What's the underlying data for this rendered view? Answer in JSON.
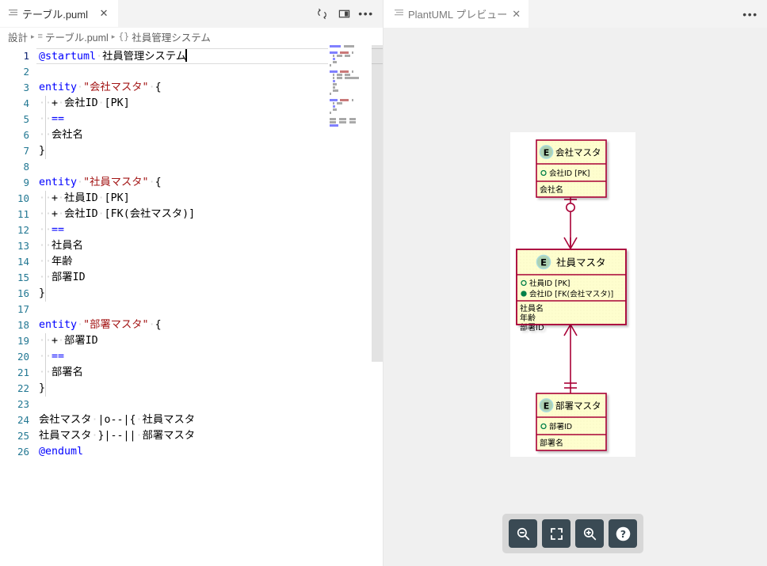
{
  "editor": {
    "tab": {
      "label": "テーブル.puml",
      "close_label": "✕",
      "file_icon": "file-code-icon"
    },
    "actions": {
      "sync_icon": "sync-changes-icon",
      "split_icon": "split-editor-right-icon",
      "more_label": "•••"
    },
    "breadcrumb": {
      "items": [
        {
          "label": "設計",
          "sym": ""
        },
        {
          "label": "テーブル.puml",
          "sym": "≡"
        },
        {
          "label": "社員管理システム",
          "sym": "{}"
        }
      ],
      "separator": "▸"
    },
    "code": {
      "line_numbers": [
        1,
        2,
        3,
        4,
        5,
        6,
        7,
        8,
        9,
        10,
        11,
        12,
        13,
        14,
        15,
        16,
        17,
        18,
        19,
        20,
        21,
        22,
        23,
        24,
        25,
        26
      ],
      "active_line": 1,
      "lines": [
        {
          "n": 1,
          "tokens": [
            {
              "t": "@startuml",
              "c": "kw"
            },
            {
              "t": "·",
              "c": "ws"
            },
            {
              "t": "社員管理システム",
              "c": "plain"
            }
          ],
          "caret": true
        },
        {
          "n": 2,
          "tokens": []
        },
        {
          "n": 3,
          "tokens": [
            {
              "t": "entity",
              "c": "kw"
            },
            {
              "t": "·",
              "c": "ws"
            },
            {
              "t": "\"会社マスタ\"",
              "c": "str"
            },
            {
              "t": "·",
              "c": "ws"
            },
            {
              "t": "{",
              "c": "plain"
            }
          ]
        },
        {
          "n": 4,
          "tokens": [
            {
              "t": "··",
              "c": "ws"
            },
            {
              "t": "+",
              "c": "plain"
            },
            {
              "t": "·",
              "c": "ws"
            },
            {
              "t": "会社ID",
              "c": "plain"
            },
            {
              "t": "·",
              "c": "ws"
            },
            {
              "t": "[PK]",
              "c": "plain"
            }
          ]
        },
        {
          "n": 5,
          "tokens": [
            {
              "t": "··",
              "c": "ws"
            },
            {
              "t": "==",
              "c": "op"
            }
          ]
        },
        {
          "n": 6,
          "tokens": [
            {
              "t": "··",
              "c": "ws"
            },
            {
              "t": "会社名",
              "c": "plain"
            }
          ]
        },
        {
          "n": 7,
          "tokens": [
            {
              "t": "}",
              "c": "plain"
            }
          ]
        },
        {
          "n": 8,
          "tokens": []
        },
        {
          "n": 9,
          "tokens": [
            {
              "t": "entity",
              "c": "kw"
            },
            {
              "t": "·",
              "c": "ws"
            },
            {
              "t": "\"社員マスタ\"",
              "c": "str"
            },
            {
              "t": "·",
              "c": "ws"
            },
            {
              "t": "{",
              "c": "plain"
            }
          ]
        },
        {
          "n": 10,
          "tokens": [
            {
              "t": "··",
              "c": "ws"
            },
            {
              "t": "+",
              "c": "plain"
            },
            {
              "t": "·",
              "c": "ws"
            },
            {
              "t": "社員ID",
              "c": "plain"
            },
            {
              "t": "·",
              "c": "ws"
            },
            {
              "t": "[PK]",
              "c": "plain"
            }
          ]
        },
        {
          "n": 11,
          "tokens": [
            {
              "t": "··",
              "c": "ws"
            },
            {
              "t": "+",
              "c": "plain"
            },
            {
              "t": "·",
              "c": "ws"
            },
            {
              "t": "会社ID",
              "c": "plain"
            },
            {
              "t": "·",
              "c": "ws"
            },
            {
              "t": "[FK(会社マスタ)]",
              "c": "plain"
            }
          ]
        },
        {
          "n": 12,
          "tokens": [
            {
              "t": "··",
              "c": "ws"
            },
            {
              "t": "==",
              "c": "op"
            }
          ]
        },
        {
          "n": 13,
          "tokens": [
            {
              "t": "··",
              "c": "ws"
            },
            {
              "t": "社員名",
              "c": "plain"
            }
          ]
        },
        {
          "n": 14,
          "tokens": [
            {
              "t": "··",
              "c": "ws"
            },
            {
              "t": "年齢",
              "c": "plain"
            }
          ]
        },
        {
          "n": 15,
          "tokens": [
            {
              "t": "··",
              "c": "ws"
            },
            {
              "t": "部署ID",
              "c": "plain"
            }
          ]
        },
        {
          "n": 16,
          "tokens": [
            {
              "t": "}",
              "c": "plain"
            }
          ]
        },
        {
          "n": 17,
          "tokens": []
        },
        {
          "n": 18,
          "tokens": [
            {
              "t": "entity",
              "c": "kw"
            },
            {
              "t": "·",
              "c": "ws"
            },
            {
              "t": "\"部署マスタ\"",
              "c": "str"
            },
            {
              "t": "·",
              "c": "ws"
            },
            {
              "t": "{",
              "c": "plain"
            }
          ]
        },
        {
          "n": 19,
          "tokens": [
            {
              "t": "··",
              "c": "ws"
            },
            {
              "t": "+",
              "c": "plain"
            },
            {
              "t": "·",
              "c": "ws"
            },
            {
              "t": "部署ID",
              "c": "plain"
            }
          ]
        },
        {
          "n": 20,
          "tokens": [
            {
              "t": "··",
              "c": "ws"
            },
            {
              "t": "==",
              "c": "op"
            }
          ]
        },
        {
          "n": 21,
          "tokens": [
            {
              "t": "··",
              "c": "ws"
            },
            {
              "t": "部署名",
              "c": "plain"
            }
          ]
        },
        {
          "n": 22,
          "tokens": [
            {
              "t": "}",
              "c": "plain"
            }
          ]
        },
        {
          "n": 23,
          "tokens": []
        },
        {
          "n": 24,
          "tokens": [
            {
              "t": "会社マスタ",
              "c": "plain"
            },
            {
              "t": "·",
              "c": "ws"
            },
            {
              "t": "|o--|{",
              "c": "plain"
            },
            {
              "t": "·",
              "c": "ws"
            },
            {
              "t": "社員マスタ",
              "c": "plain"
            }
          ]
        },
        {
          "n": 25,
          "tokens": [
            {
              "t": "社員マスタ",
              "c": "plain"
            },
            {
              "t": "·",
              "c": "ws"
            },
            {
              "t": "}|--||",
              "c": "plain"
            },
            {
              "t": "·",
              "c": "ws"
            },
            {
              "t": "部署マスタ",
              "c": "plain"
            }
          ]
        },
        {
          "n": 26,
          "tokens": [
            {
              "t": "@enduml",
              "c": "kw"
            }
          ]
        }
      ]
    }
  },
  "preview": {
    "tab": {
      "label": "PlantUML プレビュー",
      "close_label": "✕",
      "file_icon": "file-preview-icon"
    },
    "more_label": "•••",
    "toolbar": [
      {
        "name": "zoom-out-button",
        "icon": "zoom-out-icon",
        "title": "Zoom Out"
      },
      {
        "name": "fit-to-screen-button",
        "icon": "fit-screen-icon",
        "title": "Fit to Screen"
      },
      {
        "name": "zoom-in-button",
        "icon": "zoom-in-icon",
        "title": "Zoom In"
      },
      {
        "name": "help-button",
        "icon": "question-mark-icon",
        "title": "Help"
      }
    ],
    "colors": {
      "entity_fill": "#FEFECE",
      "entity_border": "#A80036",
      "stereotype_circle_fill": "#ADD1B2",
      "stereotype_circle_border": "#A9DCDF",
      "link": "#A80036",
      "canvas": "#FFFFFF",
      "panel_bg": "#F0F0F0"
    }
  },
  "chart_data": {
    "type": "diagram",
    "diagram_kind": "plantuml-entity-relationship",
    "title": "社員管理システム",
    "entities": [
      {
        "name": "会社マスタ",
        "stereotype": "E",
        "keys": [
          {
            "label": "会社ID [PK]",
            "marker": "open-circle"
          }
        ],
        "fields": [
          "会社名"
        ]
      },
      {
        "name": "社員マスタ",
        "stereotype": "E",
        "keys": [
          {
            "label": "社員ID [PK]",
            "marker": "open-circle"
          },
          {
            "label": "会社ID [FK(会社マスタ)]",
            "marker": "filled-circle"
          }
        ],
        "fields": [
          "社員名",
          "年齢",
          "部署ID"
        ]
      },
      {
        "name": "部署マスタ",
        "stereotype": "E",
        "keys": [
          {
            "label": "部署ID",
            "marker": "open-circle"
          }
        ],
        "fields": [
          "部署名"
        ]
      }
    ],
    "relations": [
      {
        "from": "会社マスタ",
        "to": "社員マスタ",
        "notation": "|o--|{",
        "from_card": "zero-or-one",
        "to_card": "one-or-many"
      },
      {
        "from": "社員マスタ",
        "to": "部署マスタ",
        "notation": "}|--||",
        "from_card": "one-or-many",
        "to_card": "exactly-one"
      }
    ]
  }
}
